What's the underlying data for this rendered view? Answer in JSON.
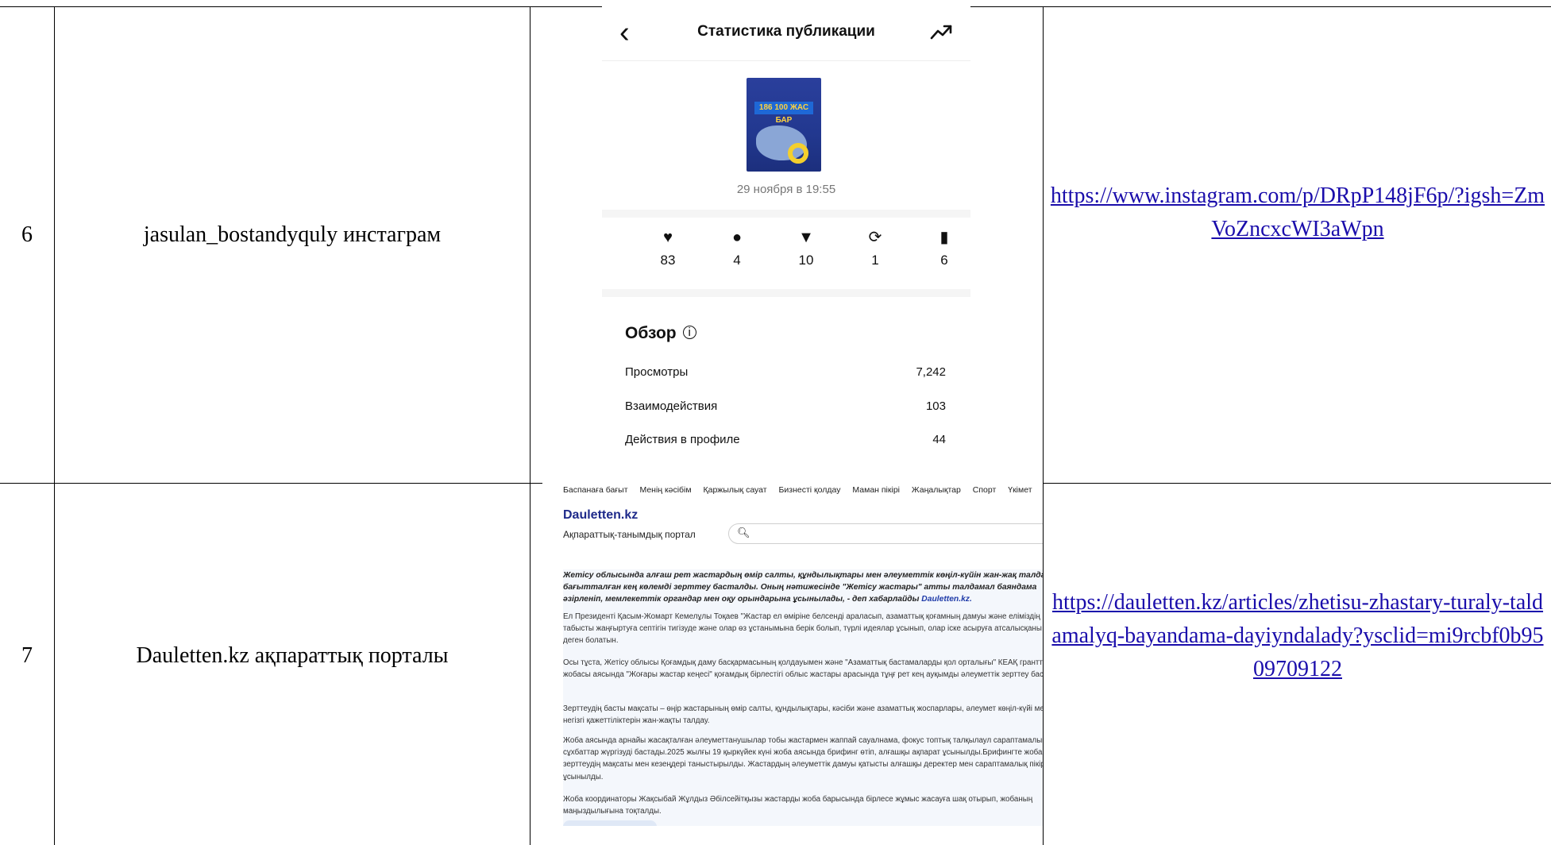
{
  "rows": [
    {
      "number": "6",
      "source": "jasulan_bostandyquly инстаграм",
      "link": "https://www.instagram.com/p/DRpP148jF6p/?igsh=ZmVoZncxcWI3aWpn"
    },
    {
      "number": "7",
      "source": "Dauletten.kz ақпараттық порталы",
      "link": "https://dauletten.kz/articles/zhetisu-zhastary-turaly-taldamalyq-bayandama-dayiyndalady?ysclid=mi9rcbf0b9509709122"
    }
  ],
  "instagram": {
    "title": "Статистика публикации",
    "back_icon": "chevron-left-icon",
    "insights_icon": "trending-up-icon",
    "thumbnail_text": "186 100 ЖАС БАР",
    "date": "29 ноября в 19:55",
    "stats": [
      {
        "icon": "heart-icon",
        "glyph": "♥",
        "value": "83"
      },
      {
        "icon": "comment-icon",
        "glyph": "●",
        "value": "4"
      },
      {
        "icon": "send-icon",
        "glyph": "▼",
        "value": "10"
      },
      {
        "icon": "repost-icon",
        "glyph": "⟳",
        "value": "1"
      },
      {
        "icon": "bookmark-icon",
        "glyph": "▮",
        "value": "6"
      }
    ],
    "overview_title": "Обзор",
    "overview": [
      {
        "label": "Просмотры",
        "value": "7,242"
      },
      {
        "label": "Взаимодействия",
        "value": "103"
      },
      {
        "label": "Действия в профиле",
        "value": "44"
      }
    ]
  },
  "dauletten": {
    "nav": [
      "Баспанаға бағыт",
      "Менің кәсібім",
      "Қаржылық сауат",
      "Бизнесті қолдау",
      "Маман пікірі",
      "Жаңалықтар",
      "Спорт",
      "Үкімет"
    ],
    "logo": "Dauletten.kz",
    "subtitle": "Ақпараттық-танымдық портал",
    "lead": "Жетісу облысында алғаш рет жастардың өмір салты, құндылықтары мен әлеуметтік көңіл-күйін жан-жақ талдауға бағытталған кең көлемді зерттеу басталды. Оның нәтижесінде \"Жетісу жастары\" атты талдамал баяндама әзірленіп, мемлекеттік органдар мен оқу орындарына ұсынылады, - деп хабарлайды",
    "lead_brand": "Dauletten.kz.",
    "paragraphs": [
      "Ел Президенті Қасым-Жомарт Кемелұлы Тоқаев \"Жастар ел өміріне белсенді араласып, азаматтық қоғамның дамуы және еліміздің табысты жаңғыртуға септігін тигізуде және олар өз ұстанымына берік болып, түрлі идеялар ұсынып, олар іске асыруға атсалысқаны жөн\" деген болатын.",
      "Осы тұста, Жетісу облысы Қоғамдық даму басқармасының қолдауымен және \"Азаматтық бастамаларды қол орталығы\" КЕАҚ гранттық жобасы аясында \"Жоғары жастар кеңесі\" қоғамдық бірлестігі облыс жастары арасында тұңғ рет кең ауқымды әлеуметтік зерттеу бастайды.",
      "Зерттеудің басты мақсаты – өңір жастарының өмір салты, құндылықтары, кәсіби және азаматтық жоспарлары, әлеумет көңіл-күйі мен негізгі қажеттіліктерін жан-жақты талдау.",
      "Жоба аясында арнайы жасақталған әлеуметтанушылар тобы жастармен жаппай сауалнама, фокус топтық талқылаул сараптамалық сұхбаттар жүргізуді бастады.2025 жылғы 19 қыркүйек күні жоба аясында брифинг өтіп, алғашқы ақпарат ұсынылды.Брифингте жоба мен зерттеудің мақсаты мен кезеңдері таныстырылды. Жастардың әлеуметтік дамуы қатысты алғашқы деректер мен сараптамалық пікірлер ұсынылды.",
      "Жоба координаторы Жақсыбай Жұлдыз Әбілсейітқызы жастарды жоба барысында бірлесе жұмыс жасауға шақ отырып, жобаның маңыздылығына тоқталды."
    ]
  }
}
